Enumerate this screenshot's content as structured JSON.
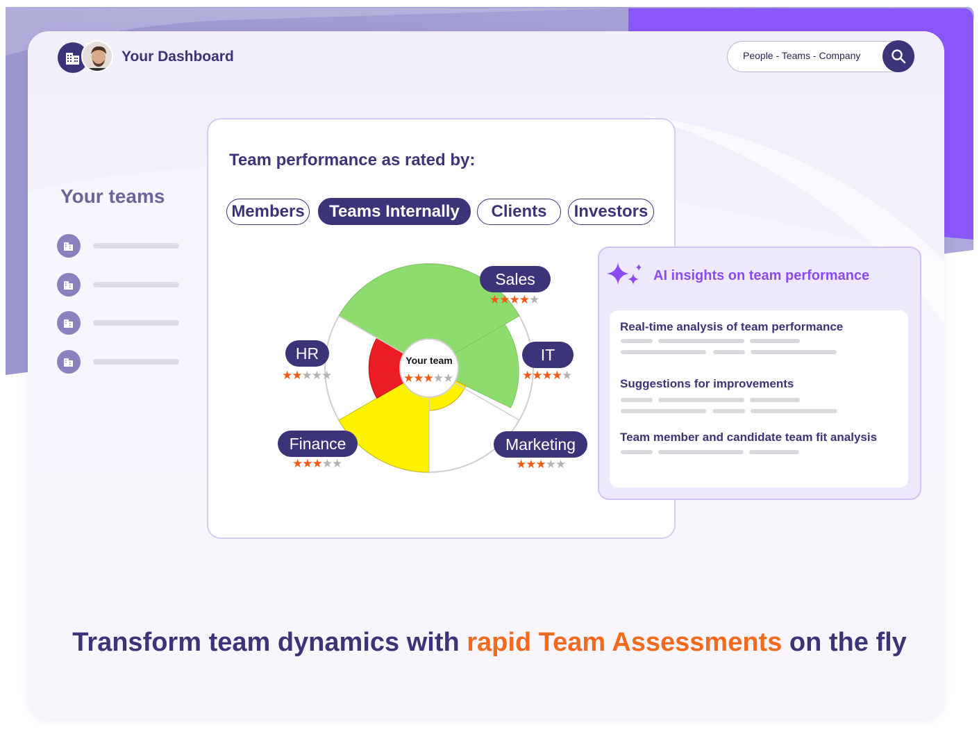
{
  "header": {
    "title": "Your Dashboard",
    "search_placeholder": "People - Teams - Company"
  },
  "sidebar": {
    "heading": "Your teams",
    "item_count_shown": 4
  },
  "performance": {
    "title": "Team performance as rated by:",
    "tabs": [
      {
        "label": "Members",
        "active": false
      },
      {
        "label": "Teams Internally",
        "active": true
      },
      {
        "label": "Clients",
        "active": false
      },
      {
        "label": "Investors",
        "active": false
      }
    ],
    "center": {
      "label": "Your team",
      "rating": 3,
      "max": 5
    },
    "segments": [
      {
        "label": "Sales",
        "rating": 4,
        "max": 5,
        "color": "#8fdc6e"
      },
      {
        "label": "IT",
        "rating": 4,
        "max": 5,
        "color": "#8fdc6e"
      },
      {
        "label": "Marketing",
        "rating": 3,
        "max": 5,
        "color": "#fff200"
      },
      {
        "label": "Finance",
        "rating": 3,
        "max": 5,
        "color": "#fff200"
      },
      {
        "label": "HR",
        "rating": 2,
        "max": 5,
        "color": "#ec1c24"
      }
    ]
  },
  "ai_panel": {
    "title": "AI insights on team performance",
    "items": [
      "Real-time analysis of team performance",
      "Suggestions for improvements",
      "Team member and candidate team fit analysis"
    ]
  },
  "tagline": {
    "before": "Transform team dynamics with ",
    "highlight": "rapid Team Assessments",
    "after": " on the fly"
  },
  "colors": {
    "primary": "#3b3478",
    "accent_orange": "#f36a1d",
    "ai_purple": "#8a4cf2",
    "star_on": "#f05a14",
    "star_off": "#b3b3b3"
  }
}
